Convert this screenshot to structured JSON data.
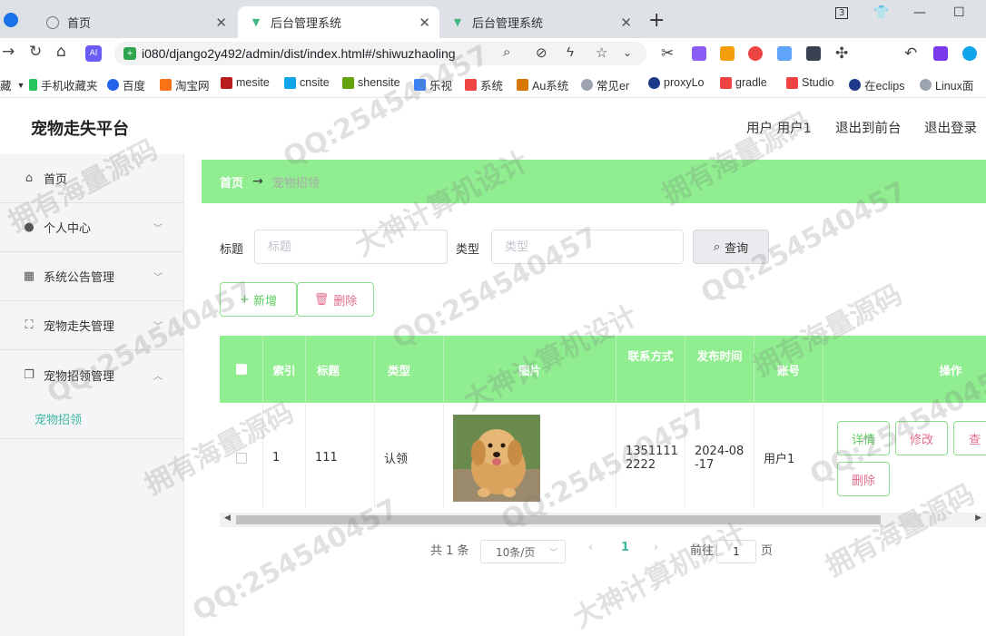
{
  "browser": {
    "tabs": [
      {
        "title": "首页",
        "icon": "globe-icon"
      },
      {
        "title": "后台管理系统",
        "icon": "vue-logo-icon"
      },
      {
        "title": "后台管理系统",
        "icon": "vue-logo-icon"
      }
    ],
    "url": "i080/django2y492/admin/dist/index.html#/shiwuzhaoling",
    "bookmarks": [
      "藏",
      "手机收藏夹",
      "百度",
      "淘宝网",
      "mesite",
      "cnsite",
      "shensite",
      "乐视",
      "系统",
      "Au系统",
      "常见er",
      "proxyLo",
      "gradle",
      "Studio",
      "在eclips",
      "Linux面"
    ],
    "tab_counter": "3"
  },
  "app": {
    "title": "宠物走失平台",
    "header_links": [
      "用户 用户1",
      "退出到前台",
      "退出登录"
    ]
  },
  "sidebar": {
    "items": [
      {
        "label": "首页",
        "icon": "home-icon"
      },
      {
        "label": "个人中心",
        "icon": "user-icon"
      },
      {
        "label": "系统公告管理",
        "icon": "grid-icon"
      },
      {
        "label": "宠物走失管理",
        "icon": "scan-icon"
      },
      {
        "label": "宠物招领管理",
        "icon": "copy-icon"
      }
    ],
    "sub_item": "宠物招领"
  },
  "breadcrumb": {
    "home": "首页",
    "arrow": "→",
    "current": "宠物招领"
  },
  "filters": {
    "title_label": "标题",
    "title_placeholder": "标题",
    "type_label": "类型",
    "type_placeholder": "类型",
    "query_label": "查询"
  },
  "actions": {
    "add_label": "新增",
    "delete_label": "删除"
  },
  "table": {
    "headers": [
      "索引",
      "标题",
      "类型",
      "图片",
      "联系方式",
      "发布时间",
      "账号",
      "操作"
    ],
    "rows": [
      {
        "index": "1",
        "title": "111",
        "type": "认领",
        "contact": "13511112222",
        "contact_l1": "1351111",
        "contact_l2": "2222",
        "date_l1": "2024-08",
        "date_l2": "-17",
        "account": "用户1",
        "ops": [
          "详情",
          "修改",
          "查",
          "删除"
        ]
      }
    ]
  },
  "pagination": {
    "total": "共 1 条",
    "page_size": "10条/页",
    "current_page": "1",
    "goto_label": "前往",
    "goto_value": "1",
    "page_suffix": "页"
  },
  "watermark": [
    "QQ:254540457",
    "拥有海量源码",
    "大神计算机设计"
  ],
  "colors": {
    "header_green": "#90ee90",
    "accent_teal": "#3fb8a0",
    "danger": "#e06c8a"
  }
}
